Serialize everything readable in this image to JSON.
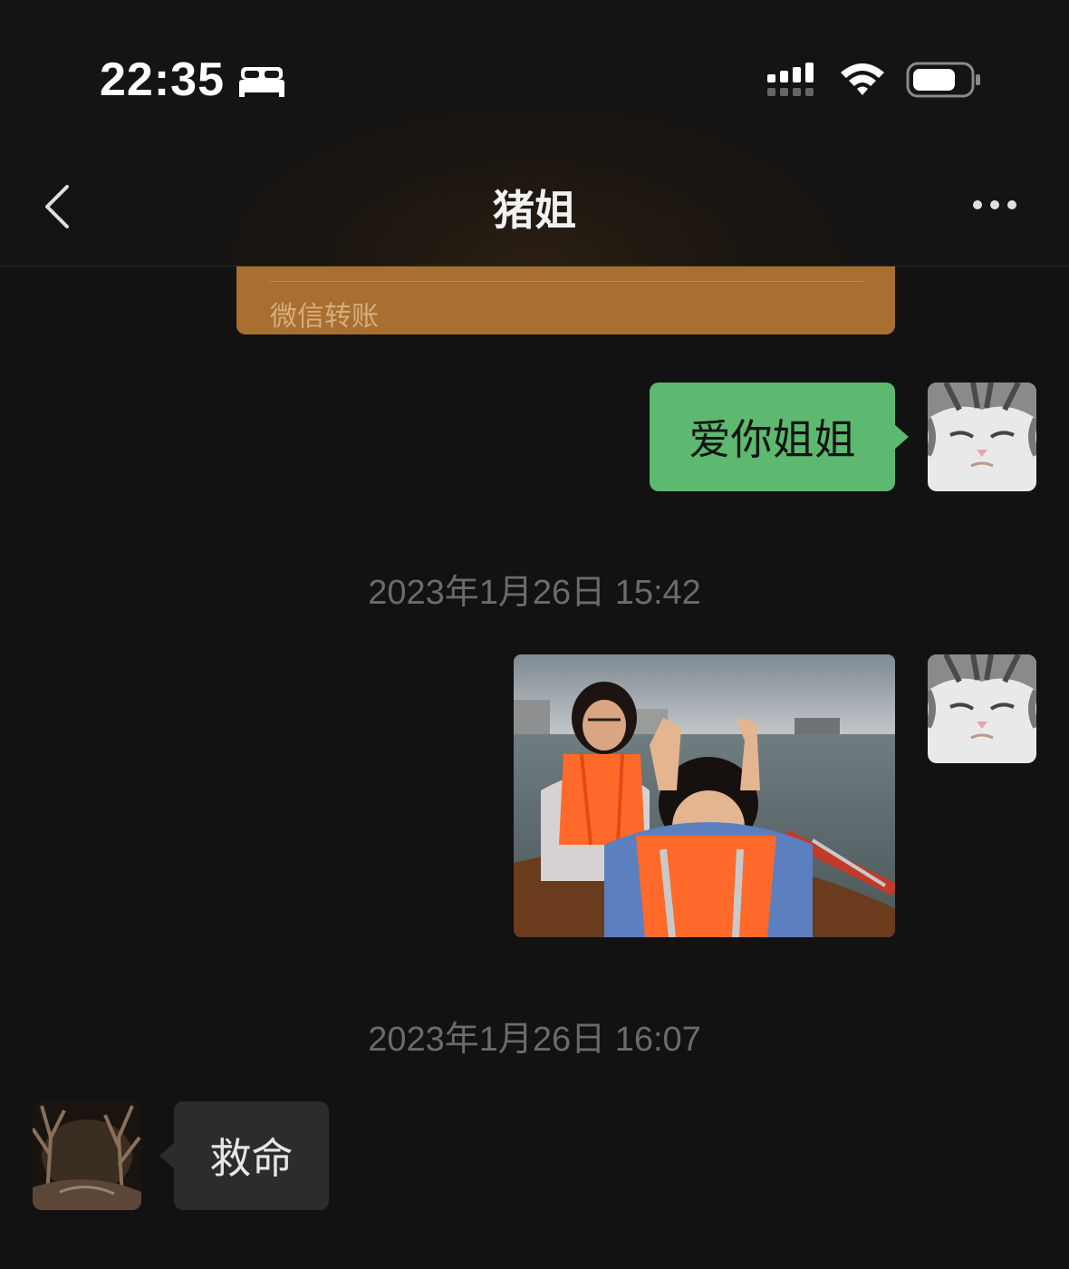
{
  "status_bar": {
    "time": "22:35",
    "icons": [
      "bed-icon",
      "signal-icon",
      "wifi-icon",
      "battery-icon"
    ]
  },
  "nav": {
    "title": "猪姐",
    "back_icon": "chevron-left-icon",
    "more_icon": "more-dots-icon"
  },
  "messages": {
    "transfer": {
      "label": "微信转账",
      "color": "#a86f31"
    },
    "outgoing_text": {
      "text": "爱你姐姐",
      "bubble_color": "#5cb96f"
    },
    "timestamp_1": "2023年1月26日 15:42",
    "outgoing_photo": {
      "type": "image"
    },
    "timestamp_2": "2023年1月26日 16:07",
    "incoming_text": {
      "text": "救命",
      "bubble_color": "#2c2c2c"
    }
  },
  "colors": {
    "background": "#121212",
    "accent_green": "#5cb96f",
    "transfer_orange": "#a86f31",
    "timestamp_gray": "#6b6b6b"
  }
}
